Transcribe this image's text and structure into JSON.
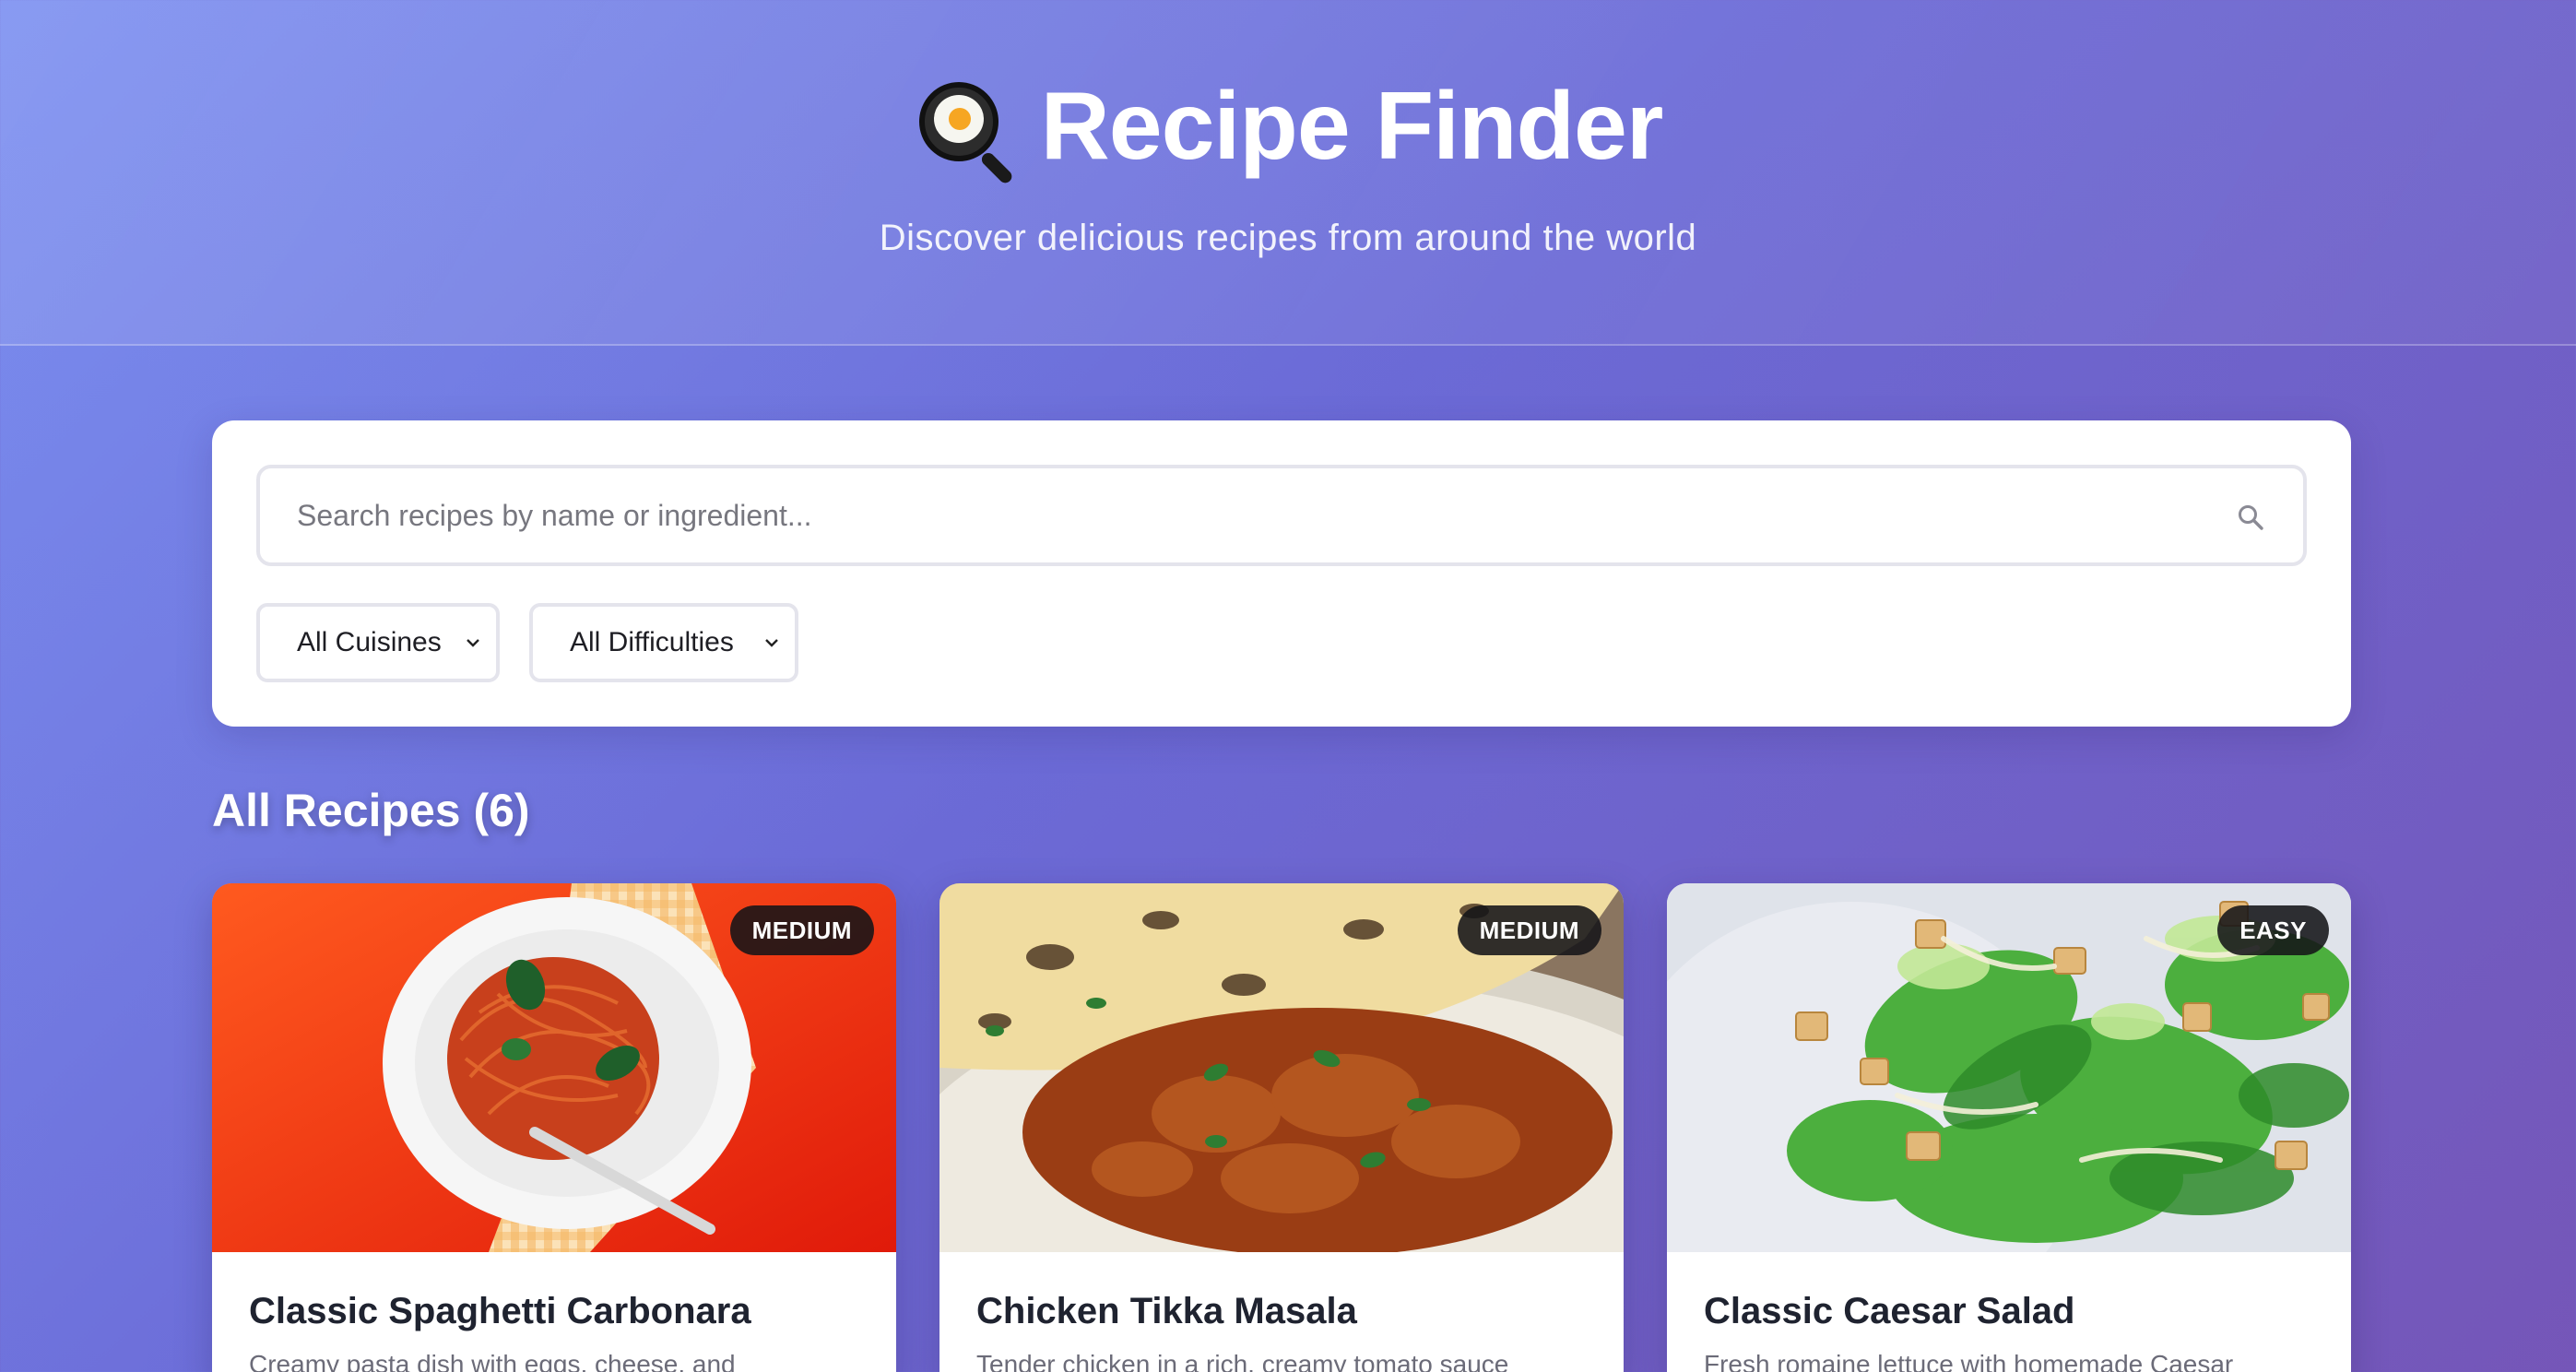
{
  "header": {
    "title": "Recipe Finder",
    "subtitle": "Discover delicious recipes from around the world",
    "logo_icon": "frying-pan-egg-icon"
  },
  "search": {
    "placeholder": "Search recipes by name or ingredient...",
    "value": "",
    "icon": "search-icon"
  },
  "filters": {
    "cuisine": {
      "selected": "All Cuisines"
    },
    "difficulty": {
      "selected": "All Difficulties"
    }
  },
  "section": {
    "title": "All Recipes (6)"
  },
  "recipes": [
    {
      "title": "Classic Spaghetti Carbonara",
      "description": "Creamy pasta dish with eggs, cheese, and",
      "difficulty": "MEDIUM"
    },
    {
      "title": "Chicken Tikka Masala",
      "description": "Tender chicken in a rich, creamy tomato sauce",
      "difficulty": "MEDIUM"
    },
    {
      "title": "Classic Caesar Salad",
      "description": "Fresh romaine lettuce with homemade Caesar",
      "difficulty": "EASY"
    }
  ],
  "colors": {
    "background_start": "#7b8ff0",
    "background_end": "#7556b8",
    "panel": "#ffffff",
    "badge": "#141418"
  }
}
